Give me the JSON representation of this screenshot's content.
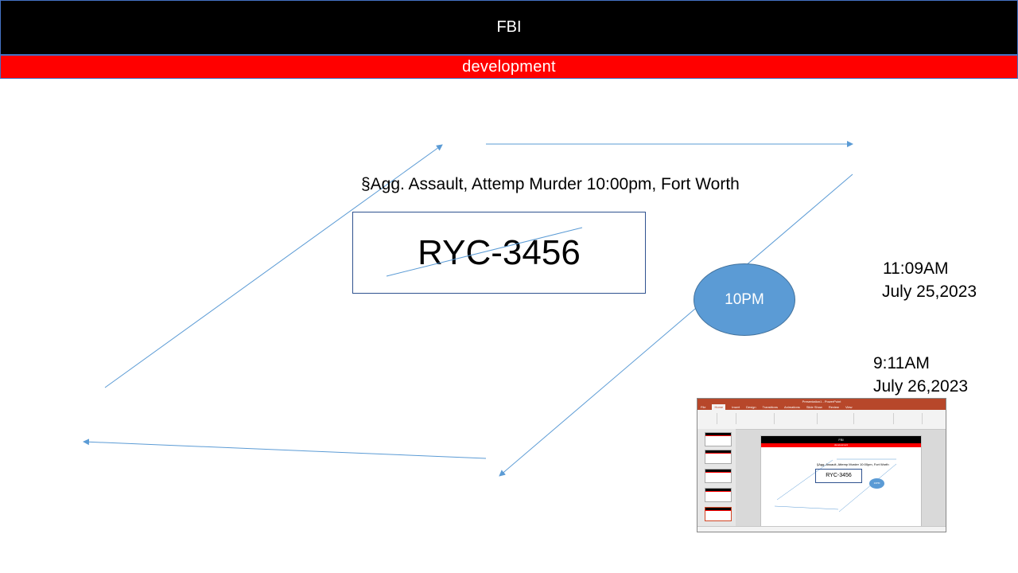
{
  "slide": {
    "title": "FBI",
    "subtitle": "development",
    "caption": "§Agg. Assault, Attemp Murder 10:00pm, Fort Worth",
    "plate": "RYC-3456",
    "circle_label": "10PM",
    "timestamps": [
      {
        "time": "11:09AM",
        "date": "July 25,2023"
      },
      {
        "time": "9:11AM",
        "date": "July 26,2023"
      }
    ]
  },
  "thumbnail": {
    "app_title": "Presentation1 - PowerPoint",
    "tabs": [
      "File",
      "Home",
      "Insert",
      "Design",
      "Transitions",
      "Animations",
      "Slide Show",
      "Review",
      "View"
    ],
    "active_tab": "Home",
    "slide_title": "FBI",
    "slide_subtitle": "development",
    "slide_caption": "§Agg. Assault, Attemp Murder 10:00pm, Fort Worth",
    "slide_plate": "RYC-3456",
    "slide_circle": "10PM"
  },
  "colors": {
    "banner": "#000000",
    "band": "#ff0000",
    "accent_line": "#5b9bd5",
    "circle_fill": "#5b9bd5"
  }
}
